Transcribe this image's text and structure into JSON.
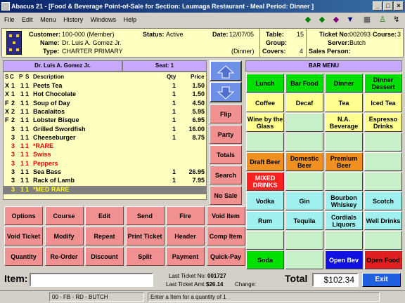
{
  "window": {
    "title": "Abacus 21 - [Food & Beverage Point-of-Sale for Section: Laumaga Restaurant - Meal Period: Dinner ]",
    "min": "_",
    "max": "□",
    "close": "×"
  },
  "menu": [
    "File",
    "Edit",
    "Menu",
    "History",
    "Windows",
    "Help"
  ],
  "header": {
    "customer_label": "Customer:",
    "customer": "100-000 (Member)",
    "name_label": "Name:",
    "name": "Dr. Luis A. Gomez Jr.",
    "type_label": "Type:",
    "type": "CHARTER PRIMARY",
    "status_label": "Status:",
    "status": "Active",
    "date_label": "Date:",
    "date": "12/07/05",
    "period": "(Dinner)",
    "table_label": "Table:",
    "table": "15",
    "group_label": "Group:",
    "covers_label": "Covers:",
    "covers": "4",
    "ticket_label": "Ticket No:",
    "ticket": "002093",
    "course_label": "Course:",
    "course": "3",
    "server_label": "Server:",
    "server": "Butch",
    "sales_label": "Sales Person:"
  },
  "guest_bar": "Dr. Luis A. Gomez Jr.",
  "seat_bar": "Seat: 1",
  "order_columns": {
    "s": "S",
    "c": "C",
    "p": "P",
    "s2": "S",
    "desc": "Description",
    "qty": "Qty",
    "price": "Price"
  },
  "order_rows": [
    {
      "sc": "X",
      "c": "1",
      "p": "1",
      "s": "1",
      "desc": "Peets Tea",
      "qty": "1",
      "price": "1.50",
      "style": ""
    },
    {
      "sc": "X",
      "c": "1",
      "p": "1",
      "s": "1",
      "desc": "Hot Chocolate",
      "qty": "1",
      "price": "1.50",
      "style": ""
    },
    {
      "sc": "F",
      "c": "2",
      "p": "1",
      "s": "1",
      "desc": "Soup of Day",
      "qty": "1",
      "price": "4.50",
      "style": ""
    },
    {
      "sc": "X",
      "c": "2",
      "p": "1",
      "s": "1",
      "desc": "Bacalaitos",
      "qty": "1",
      "price": "5.95",
      "style": ""
    },
    {
      "sc": "F",
      "c": "2",
      "p": "1",
      "s": "1",
      "desc": "Lobster Bisque",
      "qty": "1",
      "price": "6.95",
      "style": ""
    },
    {
      "sc": "",
      "c": "3",
      "p": "1",
      "s": "1",
      "desc": "Grilled Swordfish",
      "qty": "1",
      "price": "16.00",
      "style": ""
    },
    {
      "sc": "",
      "c": "3",
      "p": "1",
      "s": "1",
      "desc": "Cheeseburger",
      "qty": "1",
      "price": "8.75",
      "style": ""
    },
    {
      "sc": "",
      "c": "3",
      "p": "1",
      "s": "1",
      "desc": "*RARE",
      "qty": "",
      "price": "",
      "style": "red"
    },
    {
      "sc": "",
      "c": "3",
      "p": "1",
      "s": "1",
      "desc": "  Swiss",
      "qty": "",
      "price": "",
      "style": "red"
    },
    {
      "sc": "",
      "c": "3",
      "p": "1",
      "s": "1",
      "desc": "  Peppers",
      "qty": "",
      "price": "",
      "style": "red"
    },
    {
      "sc": "",
      "c": "3",
      "p": "1",
      "s": "1",
      "desc": "Sea Bass",
      "qty": "1",
      "price": "26.95",
      "style": ""
    },
    {
      "sc": "",
      "c": "3",
      "p": "1",
      "s": "1",
      "desc": "Rack of Lamb",
      "qty": "1",
      "price": "7.95",
      "style": ""
    },
    {
      "sc": "",
      "c": "3",
      "p": "1",
      "s": "1",
      "desc": "*MED RARE",
      "qty": "",
      "price": "",
      "style": "sel"
    }
  ],
  "side_buttons": [
    "Flip",
    "Party",
    "Totals",
    "Search",
    "No Sale"
  ],
  "func_buttons": [
    [
      "Options",
      "Course",
      "Edit",
      "Send",
      "Fire",
      "Void Item"
    ],
    [
      "Void Ticket",
      "Modify",
      "Repeat",
      "Print Ticket",
      "Header",
      "Comp Item"
    ],
    [
      "Quantity",
      "Re-Order",
      "Discount",
      "Split",
      "Payment",
      "Quick-Pay"
    ]
  ],
  "bar_menu_title": "BAR MENU",
  "bar_buttons": [
    [
      {
        "l": "Lunch",
        "c": "#00e000",
        "t": "#000"
      },
      {
        "l": "Bar Food",
        "c": "#00e000",
        "t": "#000"
      },
      {
        "l": "Dinner",
        "c": "#00e000",
        "t": "#000"
      },
      {
        "l": "Dinner Dessert",
        "c": "#00e000",
        "t": "#000"
      }
    ],
    [
      {
        "l": "Coffee",
        "c": "#ffff90",
        "t": "#000"
      },
      {
        "l": "Decaf",
        "c": "#ffff90",
        "t": "#000"
      },
      {
        "l": "Tea",
        "c": "#ffff90",
        "t": "#000"
      },
      {
        "l": "Iced Tea",
        "c": "#ffff90",
        "t": "#000"
      }
    ],
    [
      {
        "l": "Wine by the Glass",
        "c": "#ffff90",
        "t": "#000"
      },
      {
        "l": "",
        "c": "#c8f0c8",
        "t": "#000"
      },
      {
        "l": "N.A. Beverage",
        "c": "#ffff90",
        "t": "#000"
      },
      {
        "l": "Espresso Drinks",
        "c": "#ffff90",
        "t": "#000"
      }
    ],
    [
      {
        "l": "",
        "c": "#c8f0c8",
        "t": "#000"
      },
      {
        "l": "",
        "c": "#c8f0c8",
        "t": "#000"
      },
      {
        "l": "",
        "c": "#c8f0c8",
        "t": "#000"
      },
      {
        "l": "",
        "c": "#c8f0c8",
        "t": "#000"
      }
    ],
    [
      {
        "l": "Draft Beer",
        "c": "#f09020",
        "t": "#000"
      },
      {
        "l": "Domestic Beer",
        "c": "#f09020",
        "t": "#000"
      },
      {
        "l": "Premium Beer",
        "c": "#f09020",
        "t": "#000"
      },
      {
        "l": "",
        "c": "#c8f0c8",
        "t": "#000"
      }
    ],
    [
      {
        "l": "MIXED DRINKS",
        "c": "#ff2020",
        "t": "#fff"
      },
      {
        "l": "",
        "c": "#c8f0c8",
        "t": "#000"
      },
      {
        "l": "",
        "c": "#c8f0c8",
        "t": "#000"
      },
      {
        "l": "",
        "c": "#c8f0c8",
        "t": "#000"
      }
    ],
    [
      {
        "l": "Vodka",
        "c": "#a0f0f0",
        "t": "#000"
      },
      {
        "l": "Gin",
        "c": "#a0f0f0",
        "t": "#000"
      },
      {
        "l": "Bourbon Whiskey",
        "c": "#a0f0f0",
        "t": "#000"
      },
      {
        "l": "Scotch",
        "c": "#a0f0f0",
        "t": "#000"
      }
    ],
    [
      {
        "l": "Rum",
        "c": "#a0f0f0",
        "t": "#000"
      },
      {
        "l": "Tequila",
        "c": "#a0f0f0",
        "t": "#000"
      },
      {
        "l": "Cordials Liquors",
        "c": "#a0f0f0",
        "t": "#000"
      },
      {
        "l": "Well Drinks",
        "c": "#a0f0f0",
        "t": "#000"
      }
    ],
    [
      {
        "l": "",
        "c": "#c8f0c8",
        "t": "#000"
      },
      {
        "l": "",
        "c": "#c8f0c8",
        "t": "#000"
      },
      {
        "l": "",
        "c": "#c8f0c8",
        "t": "#000"
      },
      {
        "l": "",
        "c": "#c8f0c8",
        "t": "#000"
      }
    ],
    [
      {
        "l": "Soda",
        "c": "#00e000",
        "t": "#000"
      },
      {
        "l": "",
        "c": "#c8f0c8",
        "t": "#000"
      },
      {
        "l": "Open Bev",
        "c": "#1010e0",
        "t": "#fff"
      },
      {
        "l": "Open Food",
        "c": "#e02020",
        "t": "#000"
      }
    ]
  ],
  "bottom": {
    "item_label": "Item:",
    "item_value": "",
    "last_ticket_label": "Last Ticket No:",
    "last_ticket": "001727",
    "last_amt_label": "Last Ticket Amt:",
    "last_amt": "$26.14",
    "change_label": "Change:",
    "total_label": "Total",
    "total": "$102.34",
    "exit": "Exit"
  },
  "status": {
    "left": "00 - FB - RD - BUTCH",
    "right": "Enter a Item for a quantity of 1"
  }
}
